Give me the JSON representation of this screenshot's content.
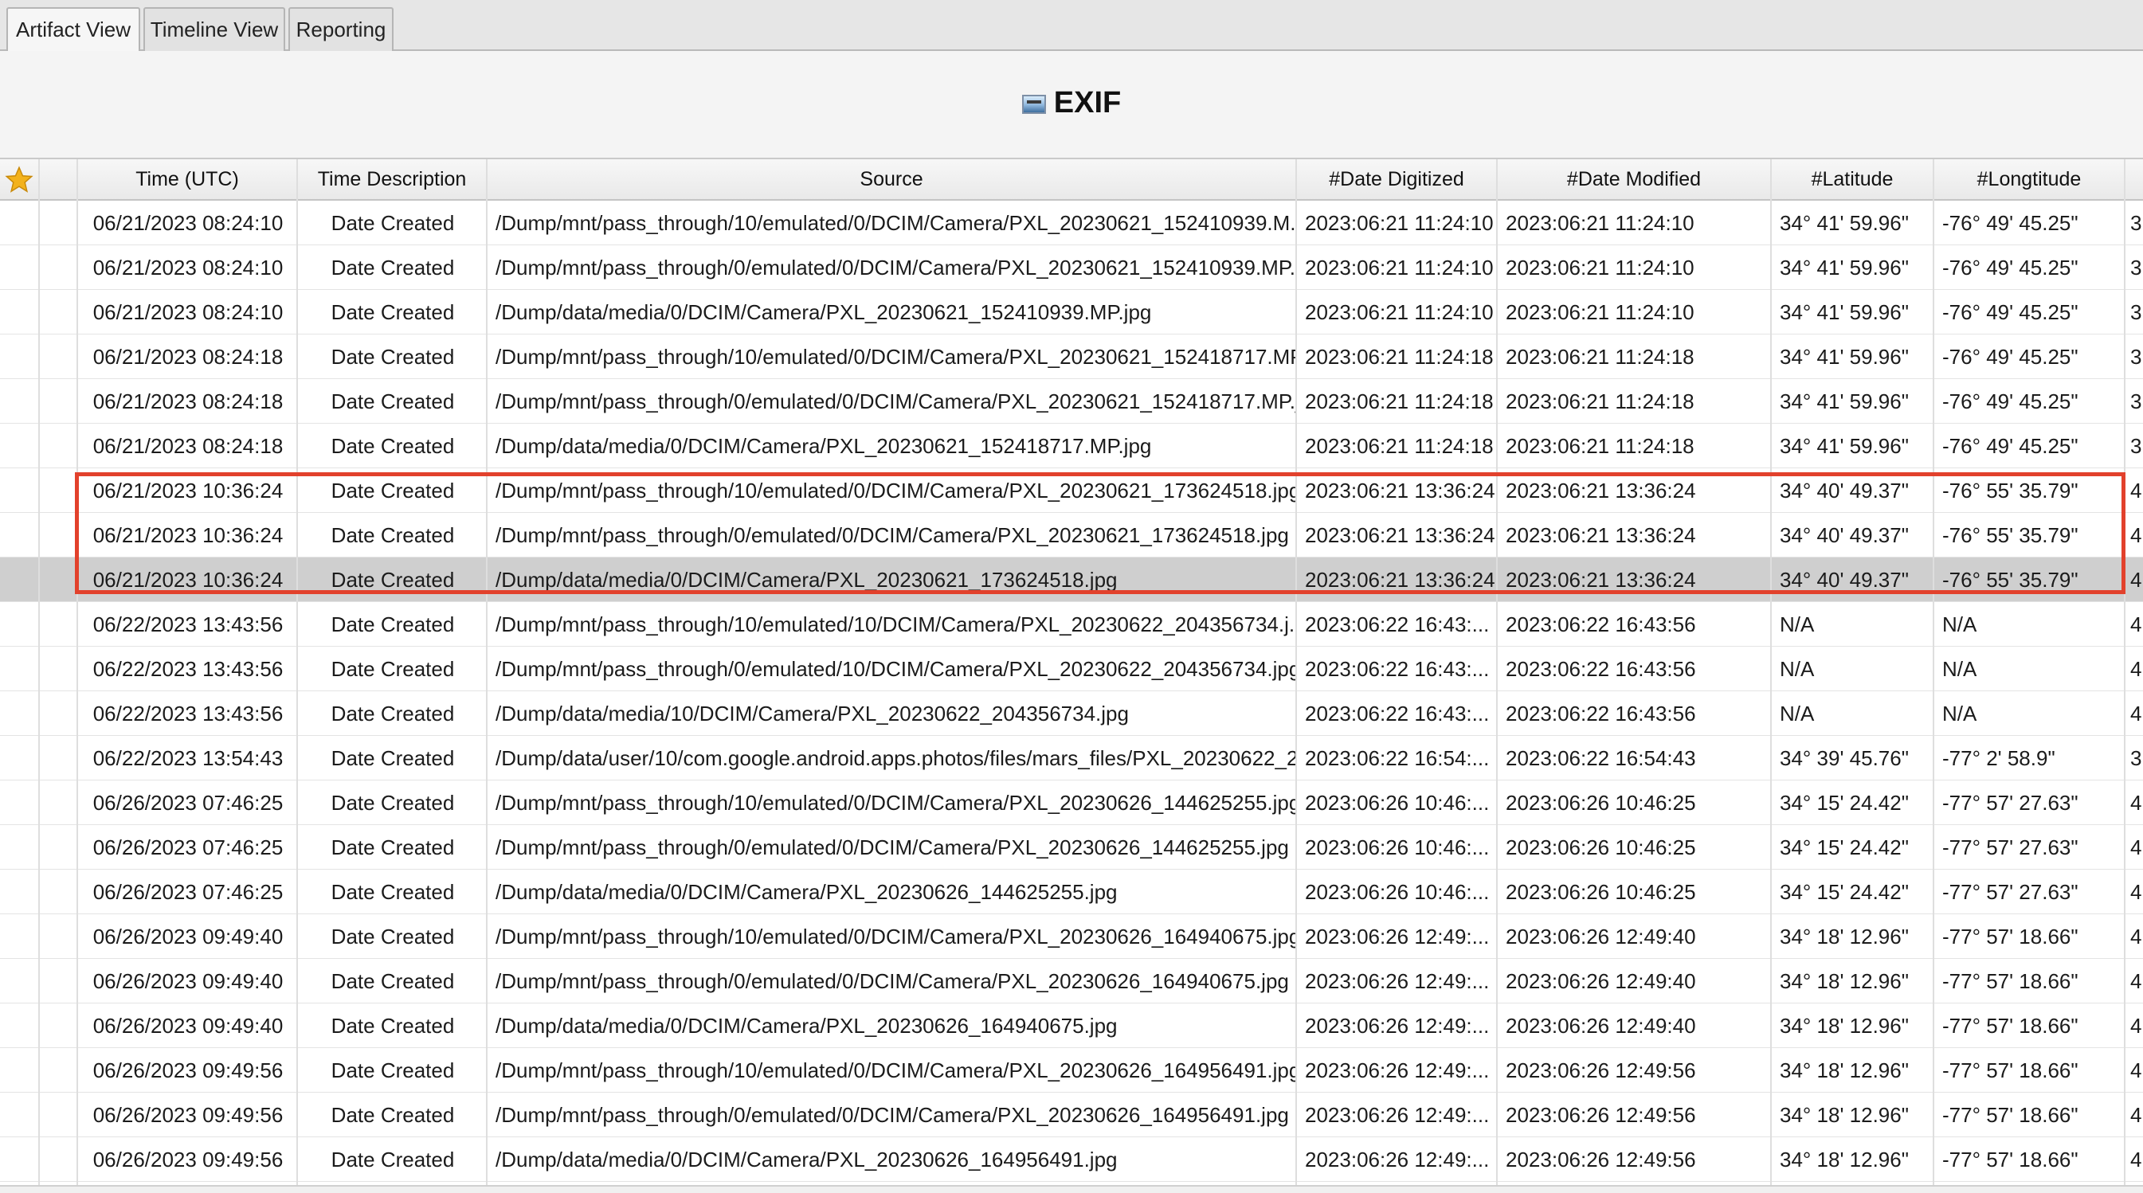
{
  "tabs": [
    {
      "label": "Artifact View",
      "active": true
    },
    {
      "label": "Timeline View",
      "active": false
    },
    {
      "label": "Reporting",
      "active": false
    }
  ],
  "title": {
    "text": "EXIF",
    "icon": "image-file-icon"
  },
  "table": {
    "columns": [
      "",
      "",
      "Time (UTC)",
      "Time Description",
      "Source",
      "#Date Digitized",
      "#Date Modified",
      "#Latitude",
      "#Longtitude"
    ],
    "selected_row": 8,
    "highlight_color": "#e2412c",
    "rows": [
      {
        "time": "06/21/2023 08:24:10",
        "desc": "Date Created",
        "source": "/Dump/mnt/pass_through/10/emulated/0/DCIM/Camera/PXL_20230621_152410939.M...",
        "digitized": "2023:06:21 11:24:10",
        "modified": "2023:06:21 11:24:10",
        "lat": "34° 41' 59.96\"",
        "lon": "-76° 49' 45.25\"",
        "extra": "3"
      },
      {
        "time": "06/21/2023 08:24:10",
        "desc": "Date Created",
        "source": "/Dump/mnt/pass_through/0/emulated/0/DCIM/Camera/PXL_20230621_152410939.MP....",
        "digitized": "2023:06:21 11:24:10",
        "modified": "2023:06:21 11:24:10",
        "lat": "34° 41' 59.96\"",
        "lon": "-76° 49' 45.25\"",
        "extra": "3"
      },
      {
        "time": "06/21/2023 08:24:10",
        "desc": "Date Created",
        "source": "/Dump/data/media/0/DCIM/Camera/PXL_20230621_152410939.MP.jpg",
        "digitized": "2023:06:21 11:24:10",
        "modified": "2023:06:21 11:24:10",
        "lat": "34° 41' 59.96\"",
        "lon": "-76° 49' 45.25\"",
        "extra": "3"
      },
      {
        "time": "06/21/2023 08:24:18",
        "desc": "Date Created",
        "source": "/Dump/mnt/pass_through/10/emulated/0/DCIM/Camera/PXL_20230621_152418717.MP...",
        "digitized": "2023:06:21 11:24:18",
        "modified": "2023:06:21 11:24:18",
        "lat": "34° 41' 59.96\"",
        "lon": "-76° 49' 45.25\"",
        "extra": "3"
      },
      {
        "time": "06/21/2023 08:24:18",
        "desc": "Date Created",
        "source": "/Dump/mnt/pass_through/0/emulated/0/DCIM/Camera/PXL_20230621_152418717.MP.j...",
        "digitized": "2023:06:21 11:24:18",
        "modified": "2023:06:21 11:24:18",
        "lat": "34° 41' 59.96\"",
        "lon": "-76° 49' 45.25\"",
        "extra": "3"
      },
      {
        "time": "06/21/2023 08:24:18",
        "desc": "Date Created",
        "source": "/Dump/data/media/0/DCIM/Camera/PXL_20230621_152418717.MP.jpg",
        "digitized": "2023:06:21 11:24:18",
        "modified": "2023:06:21 11:24:18",
        "lat": "34° 41' 59.96\"",
        "lon": "-76° 49' 45.25\"",
        "extra": "3"
      },
      {
        "time": "06/21/2023 10:36:24",
        "desc": "Date Created",
        "source": "/Dump/mnt/pass_through/10/emulated/0/DCIM/Camera/PXL_20230621_173624518.jpg",
        "digitized": "2023:06:21 13:36:24",
        "modified": "2023:06:21 13:36:24",
        "lat": "34° 40' 49.37\"",
        "lon": "-76° 55' 35.79\"",
        "extra": "4"
      },
      {
        "time": "06/21/2023 10:36:24",
        "desc": "Date Created",
        "source": "/Dump/mnt/pass_through/0/emulated/0/DCIM/Camera/PXL_20230621_173624518.jpg",
        "digitized": "2023:06:21 13:36:24",
        "modified": "2023:06:21 13:36:24",
        "lat": "34° 40' 49.37\"",
        "lon": "-76° 55' 35.79\"",
        "extra": "4"
      },
      {
        "time": "06/21/2023 10:36:24",
        "desc": "Date Created",
        "source": "/Dump/data/media/0/DCIM/Camera/PXL_20230621_173624518.jpg",
        "digitized": "2023:06:21 13:36:24",
        "modified": "2023:06:21 13:36:24",
        "lat": "34° 40' 49.37\"",
        "lon": "-76° 55' 35.79\"",
        "extra": "4"
      },
      {
        "time": "06/22/2023 13:43:56",
        "desc": "Date Created",
        "source": "/Dump/mnt/pass_through/10/emulated/10/DCIM/Camera/PXL_20230622_204356734.j...",
        "digitized": "2023:06:22 16:43:...",
        "modified": "2023:06:22 16:43:56",
        "lat": "N/A",
        "lon": "N/A",
        "extra": "4"
      },
      {
        "time": "06/22/2023 13:43:56",
        "desc": "Date Created",
        "source": "/Dump/mnt/pass_through/0/emulated/10/DCIM/Camera/PXL_20230622_204356734.jpg",
        "digitized": "2023:06:22 16:43:...",
        "modified": "2023:06:22 16:43:56",
        "lat": "N/A",
        "lon": "N/A",
        "extra": "4"
      },
      {
        "time": "06/22/2023 13:43:56",
        "desc": "Date Created",
        "source": "/Dump/data/media/10/DCIM/Camera/PXL_20230622_204356734.jpg",
        "digitized": "2023:06:22 16:43:...",
        "modified": "2023:06:22 16:43:56",
        "lat": "N/A",
        "lon": "N/A",
        "extra": "4"
      },
      {
        "time": "06/22/2023 13:54:43",
        "desc": "Date Created",
        "source": "/Dump/data/user/10/com.google.android.apps.photos/files/mars_files/PXL_20230622_2...",
        "digitized": "2023:06:22 16:54:...",
        "modified": "2023:06:22 16:54:43",
        "lat": "34° 39' 45.76\"",
        "lon": "-77° 2' 58.9\"",
        "extra": "3"
      },
      {
        "time": "06/26/2023 07:46:25",
        "desc": "Date Created",
        "source": "/Dump/mnt/pass_through/10/emulated/0/DCIM/Camera/PXL_20230626_144625255.jpg",
        "digitized": "2023:06:26 10:46:...",
        "modified": "2023:06:26 10:46:25",
        "lat": "34° 15' 24.42\"",
        "lon": "-77° 57' 27.63\"",
        "extra": "4"
      },
      {
        "time": "06/26/2023 07:46:25",
        "desc": "Date Created",
        "source": "/Dump/mnt/pass_through/0/emulated/0/DCIM/Camera/PXL_20230626_144625255.jpg",
        "digitized": "2023:06:26 10:46:...",
        "modified": "2023:06:26 10:46:25",
        "lat": "34° 15' 24.42\"",
        "lon": "-77° 57' 27.63\"",
        "extra": "4"
      },
      {
        "time": "06/26/2023 07:46:25",
        "desc": "Date Created",
        "source": "/Dump/data/media/0/DCIM/Camera/PXL_20230626_144625255.jpg",
        "digitized": "2023:06:26 10:46:...",
        "modified": "2023:06:26 10:46:25",
        "lat": "34° 15' 24.42\"",
        "lon": "-77° 57' 27.63\"",
        "extra": "4"
      },
      {
        "time": "06/26/2023 09:49:40",
        "desc": "Date Created",
        "source": "/Dump/mnt/pass_through/10/emulated/0/DCIM/Camera/PXL_20230626_164940675.jpg",
        "digitized": "2023:06:26 12:49:...",
        "modified": "2023:06:26 12:49:40",
        "lat": "34° 18' 12.96\"",
        "lon": "-77° 57' 18.66\"",
        "extra": "4"
      },
      {
        "time": "06/26/2023 09:49:40",
        "desc": "Date Created",
        "source": "/Dump/mnt/pass_through/0/emulated/0/DCIM/Camera/PXL_20230626_164940675.jpg",
        "digitized": "2023:06:26 12:49:...",
        "modified": "2023:06:26 12:49:40",
        "lat": "34° 18' 12.96\"",
        "lon": "-77° 57' 18.66\"",
        "extra": "4"
      },
      {
        "time": "06/26/2023 09:49:40",
        "desc": "Date Created",
        "source": "/Dump/data/media/0/DCIM/Camera/PXL_20230626_164940675.jpg",
        "digitized": "2023:06:26 12:49:...",
        "modified": "2023:06:26 12:49:40",
        "lat": "34° 18' 12.96\"",
        "lon": "-77° 57' 18.66\"",
        "extra": "4"
      },
      {
        "time": "06/26/2023 09:49:56",
        "desc": "Date Created",
        "source": "/Dump/mnt/pass_through/10/emulated/0/DCIM/Camera/PXL_20230626_164956491.jpg",
        "digitized": "2023:06:26 12:49:...",
        "modified": "2023:06:26 12:49:56",
        "lat": "34° 18' 12.96\"",
        "lon": "-77° 57' 18.66\"",
        "extra": "4"
      },
      {
        "time": "06/26/2023 09:49:56",
        "desc": "Date Created",
        "source": "/Dump/mnt/pass_through/0/emulated/0/DCIM/Camera/PXL_20230626_164956491.jpg",
        "digitized": "2023:06:26 12:49:...",
        "modified": "2023:06:26 12:49:56",
        "lat": "34° 18' 12.96\"",
        "lon": "-77° 57' 18.66\"",
        "extra": "4"
      },
      {
        "time": "06/26/2023 09:49:56",
        "desc": "Date Created",
        "source": "/Dump/data/media/0/DCIM/Camera/PXL_20230626_164956491.jpg",
        "digitized": "2023:06:26 12:49:...",
        "modified": "2023:06:26 12:49:56",
        "lat": "34° 18' 12.96\"",
        "lon": "-77° 57' 18.66\"",
        "extra": "4"
      }
    ]
  }
}
